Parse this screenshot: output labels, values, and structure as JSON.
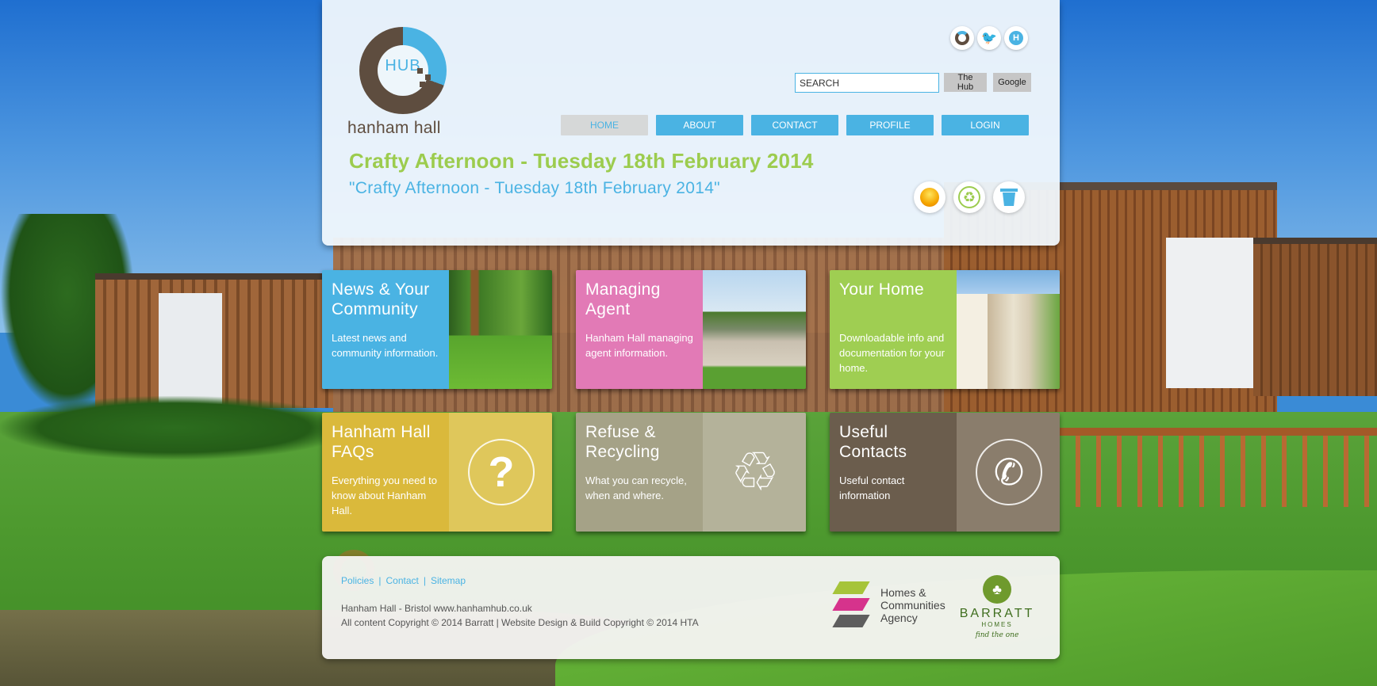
{
  "brand": {
    "logo_hub": "HUB",
    "logo_text": "hanham hall"
  },
  "colors": {
    "blue": "#4ab3e3",
    "green": "#9ccc4e",
    "pink": "#e27ab6",
    "mustard": "#dab93b",
    "khaki": "#a5a287",
    "brown": "#6b5d4d"
  },
  "social": [
    "hub-ring-icon",
    "twitter-icon",
    "h-badge-icon"
  ],
  "search": {
    "value": "SEARCH",
    "button_hub": "The Hub",
    "button_google": "Google"
  },
  "nav": {
    "items": [
      {
        "label": "HOME",
        "active": true
      },
      {
        "label": "ABOUT",
        "active": false
      },
      {
        "label": "CONTACT",
        "active": false
      },
      {
        "label": "PROFILE",
        "active": false
      },
      {
        "label": "LOGIN",
        "active": false
      }
    ]
  },
  "page": {
    "title": "Crafty Afternoon - Tuesday 18th February 2014",
    "subtitle": "\"Crafty Afternoon - Tuesday 18th February 2014\""
  },
  "eco_icons": [
    "sun-icon",
    "recycle-icon",
    "bin-icon"
  ],
  "tiles": [
    {
      "title": "News & Your Community",
      "desc": "Latest news and community information.",
      "icon": "park-photo"
    },
    {
      "title": "Managing Agent",
      "desc": "Hanham Hall managing agent information.",
      "icon": "road-photo"
    },
    {
      "title": "Your Home",
      "desc": "Downloadable info and documentation for your home.",
      "icon": "flats-photo"
    },
    {
      "title": "Hanham Hall FAQs",
      "desc": "Everything you need to know about Hanham Hall.",
      "icon": "question-icon"
    },
    {
      "title": "Refuse & Recycling",
      "desc": "What you can recycle, when and where.",
      "icon": "recycle-icon"
    },
    {
      "title": "Useful Contacts",
      "desc": "Useful contact information",
      "icon": "phone-icon"
    }
  ],
  "footer": {
    "links": [
      "Policies",
      "Contact",
      "Sitemap"
    ],
    "line1": "Hanham Hall - Bristol  www.hanhamhub.co.uk",
    "line2": "All content Copyright © 2014 Barratt  |  Website Design & Build Copyright © 2014 HTA",
    "hca_line1": "Homes &",
    "hca_line2": "Communities",
    "hca_line3": "Agency",
    "barratt_name": "BARRATT",
    "barratt_homes": "HOMES",
    "barratt_tag": "find the one"
  }
}
